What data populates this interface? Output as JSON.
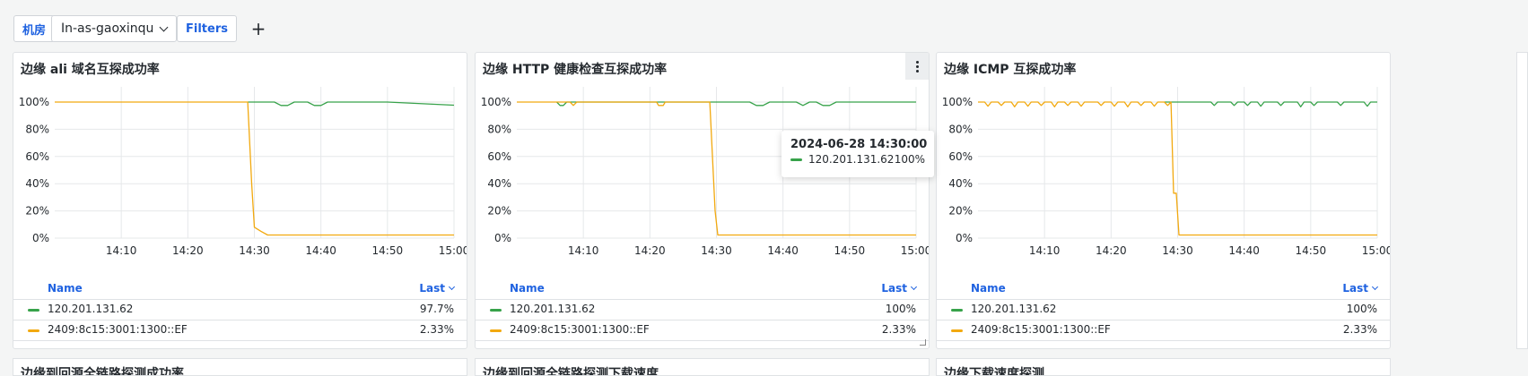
{
  "toolbar": {
    "room_label": "机房",
    "room_value": "In-as-gaoxinqu",
    "filters_label": "Filters",
    "add_label": "+"
  },
  "colors": {
    "green": "#37a24a",
    "yellow": "#f2a90f",
    "link": "#1f62e0"
  },
  "legend_header": {
    "name": "Name",
    "last": "Last"
  },
  "panels": [
    {
      "title": "边缘 ali 域名互探成功率",
      "rows": [
        {
          "label": "120.201.131.62",
          "value": "97.7%"
        },
        {
          "label": "2409:8c15:3001:1300::EF",
          "value": "2.33%"
        }
      ]
    },
    {
      "title": "边缘 HTTP 健康检查互探成功率",
      "rows": [
        {
          "label": "120.201.131.62",
          "value": "100%"
        },
        {
          "label": "2409:8c15:3001:1300::EF",
          "value": "2.33%"
        }
      ]
    },
    {
      "title": "边缘 ICMP 互探成功率",
      "rows": [
        {
          "label": "120.201.131.62",
          "value": "100%"
        },
        {
          "label": "2409:8c15:3001:1300::EF",
          "value": "2.33%"
        }
      ]
    }
  ],
  "tooltip": {
    "time": "2024-06-28 14:30:00",
    "label": "120.201.131.62",
    "value": "100%"
  },
  "stubs": [
    "边缘到回源全链路探测成功率",
    "边缘到回源全链路探测下载速度",
    "边缘下载速度探测"
  ],
  "chart_data": [
    {
      "type": "line",
      "title": "边缘 ali 域名互探成功率",
      "x_ticks": [
        "14:10",
        "14:20",
        "14:30",
        "14:40",
        "14:50",
        "15:00"
      ],
      "y_ticks": [
        "0%",
        "20%",
        "40%",
        "60%",
        "80%",
        "100%"
      ],
      "ylim": [
        0,
        100
      ],
      "xlim": [
        "14:00",
        "15:00"
      ],
      "grid": true,
      "series": [
        {
          "name": "120.201.131.62",
          "color": "#37a24a",
          "x": [
            "14:29",
            "14:33",
            "14:34",
            "14:35",
            "14:36",
            "14:37",
            "14:38",
            "14:39",
            "14:40",
            "14:41",
            "14:42",
            "14:43",
            "14:50",
            "15:00"
          ],
          "y": [
            100,
            100,
            97.5,
            97.5,
            100,
            100,
            100,
            97.5,
            97.5,
            100,
            100,
            100,
            100,
            97.7
          ]
        },
        {
          "name": "2409:8c15:3001:1300::EF",
          "color": "#f2a90f",
          "x": [
            "14:00",
            "14:10",
            "14:20",
            "14:29",
            "14:29.6",
            "14:30",
            "14:31",
            "14:32",
            "14:40",
            "14:50",
            "15:00"
          ],
          "y": [
            100,
            100,
            100,
            100,
            40,
            8,
            5,
            2.33,
            2.33,
            2.33,
            2.33
          ]
        }
      ]
    },
    {
      "type": "line",
      "title": "边缘 HTTP 健康检查互探成功率",
      "x_ticks": [
        "14:10",
        "14:20",
        "14:30",
        "14:40",
        "14:50",
        "15:00"
      ],
      "y_ticks": [
        "0%",
        "20%",
        "40%",
        "60%",
        "80%",
        "100%"
      ],
      "ylim": [
        0,
        100
      ],
      "xlim": [
        "14:00",
        "15:00"
      ],
      "grid": true,
      "series": [
        {
          "name": "120.201.131.62",
          "color": "#37a24a",
          "x": [
            "14:06",
            "14:06.5",
            "14:07",
            "14:07.5",
            "14:08",
            "14:30",
            "14:35",
            "14:36",
            "14:37",
            "14:38",
            "14:40",
            "14:42",
            "14:43",
            "14:44",
            "14:45",
            "14:46",
            "14:47",
            "14:48",
            "15:00"
          ],
          "y": [
            100,
            97.5,
            97.5,
            100,
            100,
            100,
            100,
            97.5,
            97.5,
            100,
            100,
            100,
            97.5,
            100,
            100,
            97.5,
            97.5,
            100,
            100
          ]
        },
        {
          "name": "2409:8c15:3001:1300::EF",
          "color": "#f2a90f",
          "x": [
            "14:00",
            "14:08",
            "14:08.5",
            "14:09",
            "14:21",
            "14:21.3",
            "14:22",
            "14:22.3",
            "14:29",
            "14:29.8",
            "14:30.2",
            "14:31",
            "14:40",
            "14:50",
            "15:00"
          ],
          "y": [
            100,
            100,
            97.5,
            100,
            100,
            97.5,
            97.5,
            100,
            100,
            20,
            2.33,
            2.33,
            2.33,
            2.33,
            2.33
          ]
        }
      ]
    },
    {
      "type": "line",
      "title": "边缘 ICMP 互探成功率",
      "x_ticks": [
        "14:10",
        "14:20",
        "14:30",
        "14:40",
        "14:50",
        "15:00"
      ],
      "y_ticks": [
        "0%",
        "20%",
        "40%",
        "60%",
        "80%",
        "100%"
      ],
      "ylim": [
        0,
        100
      ],
      "xlim": [
        "14:00",
        "15:00"
      ],
      "grid": true,
      "series": [
        {
          "name": "120.201.131.62",
          "color": "#37a24a",
          "x": [
            "14:28",
            "14:29",
            "14:35",
            "14:35.5",
            "14:36",
            "14:38",
            "14:38.5",
            "14:39",
            "14:40",
            "14:40.5",
            "14:41",
            "14:42",
            "14:42.5",
            "14:43",
            "14:45",
            "14:45.5",
            "14:46",
            "14:48",
            "14:48.5",
            "14:49",
            "14:50",
            "14:50.5",
            "14:51",
            "14:54",
            "14:54.5",
            "14:55",
            "14:58",
            "14:58.5",
            "14:59",
            "15:00"
          ],
          "y": [
            100,
            100,
            100,
            97.5,
            100,
            100,
            97.5,
            100,
            100,
            97.5,
            100,
            100,
            97,
            100,
            100,
            97.5,
            100,
            100,
            96.5,
            100,
            100,
            97.5,
            100,
            100,
            97.5,
            100,
            100,
            97,
            100,
            100
          ]
        },
        {
          "name": "2409:8c15:3001:1300::EF",
          "color": "#f2a90f",
          "x": [
            "14:00",
            "14:01",
            "14:01.5",
            "14:02",
            "14:03",
            "14:03.5",
            "14:04",
            "14:05",
            "14:05.5",
            "14:06",
            "14:07",
            "14:07.5",
            "14:08",
            "14:09",
            "14:09.5",
            "14:10",
            "14:11",
            "14:11.5",
            "14:12",
            "14:13",
            "14:13.5",
            "14:14",
            "14:15",
            "14:15.5",
            "14:16",
            "14:18",
            "14:18.5",
            "14:19",
            "14:20",
            "14:20.5",
            "14:21",
            "14:22",
            "14:22.5",
            "14:23",
            "14:24",
            "14:24.5",
            "14:25",
            "14:26",
            "14:26.5",
            "14:27",
            "14:28",
            "14:28.5",
            "14:29",
            "14:29.4",
            "14:29.8",
            "14:30.2",
            "14:31",
            "14:40",
            "14:50",
            "15:00"
          ],
          "y": [
            100,
            100,
            97,
            100,
            100,
            97.5,
            100,
            100,
            96.5,
            100,
            100,
            97,
            100,
            100,
            97.5,
            100,
            100,
            96.5,
            100,
            100,
            97.5,
            100,
            100,
            97,
            100,
            100,
            97.5,
            100,
            100,
            97,
            100,
            100,
            96.5,
            100,
            100,
            97.5,
            100,
            100,
            97,
            100,
            100,
            97.5,
            100,
            33,
            33,
            2.33,
            2.33,
            2.33,
            2.33,
            2.33
          ]
        }
      ]
    }
  ]
}
